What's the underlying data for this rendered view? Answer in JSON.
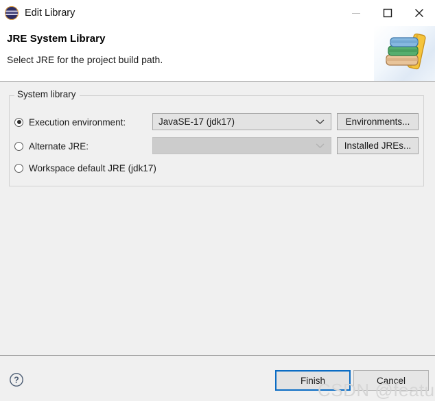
{
  "window": {
    "title": "Edit Library",
    "app_icon": "eclipse-icon",
    "controls": {
      "minimize": "minimize-icon",
      "maximize": "maximize-icon",
      "close": "close-icon"
    }
  },
  "header": {
    "title": "JRE System Library",
    "subtitle": "Select JRE for the project build path.",
    "banner_icon": "books-icon"
  },
  "main": {
    "group": {
      "label": "System library",
      "options": [
        {
          "id": "execution-environment",
          "label": "Execution environment:",
          "selected": true,
          "combo_value": "JavaSE-17 (jdk17)",
          "combo_enabled": true,
          "button_label": "Environments..."
        },
        {
          "id": "alternate-jre",
          "label": "Alternate JRE:",
          "selected": false,
          "combo_value": "",
          "combo_enabled": false,
          "button_label": "Installed JREs..."
        },
        {
          "id": "workspace-default-jre",
          "label": "Workspace default JRE (jdk17)",
          "selected": false
        }
      ]
    }
  },
  "footer": {
    "help_icon": "help-icon",
    "finish_label": "Finish",
    "cancel_label": "Cancel"
  },
  "watermark": {
    "text": "CSDN @featureA"
  },
  "colors": {
    "accent": "#0a6cc4",
    "dialog_bg": "#f0f0f0",
    "header_bg": "#ffffff",
    "separator": "#a0a0a0"
  }
}
